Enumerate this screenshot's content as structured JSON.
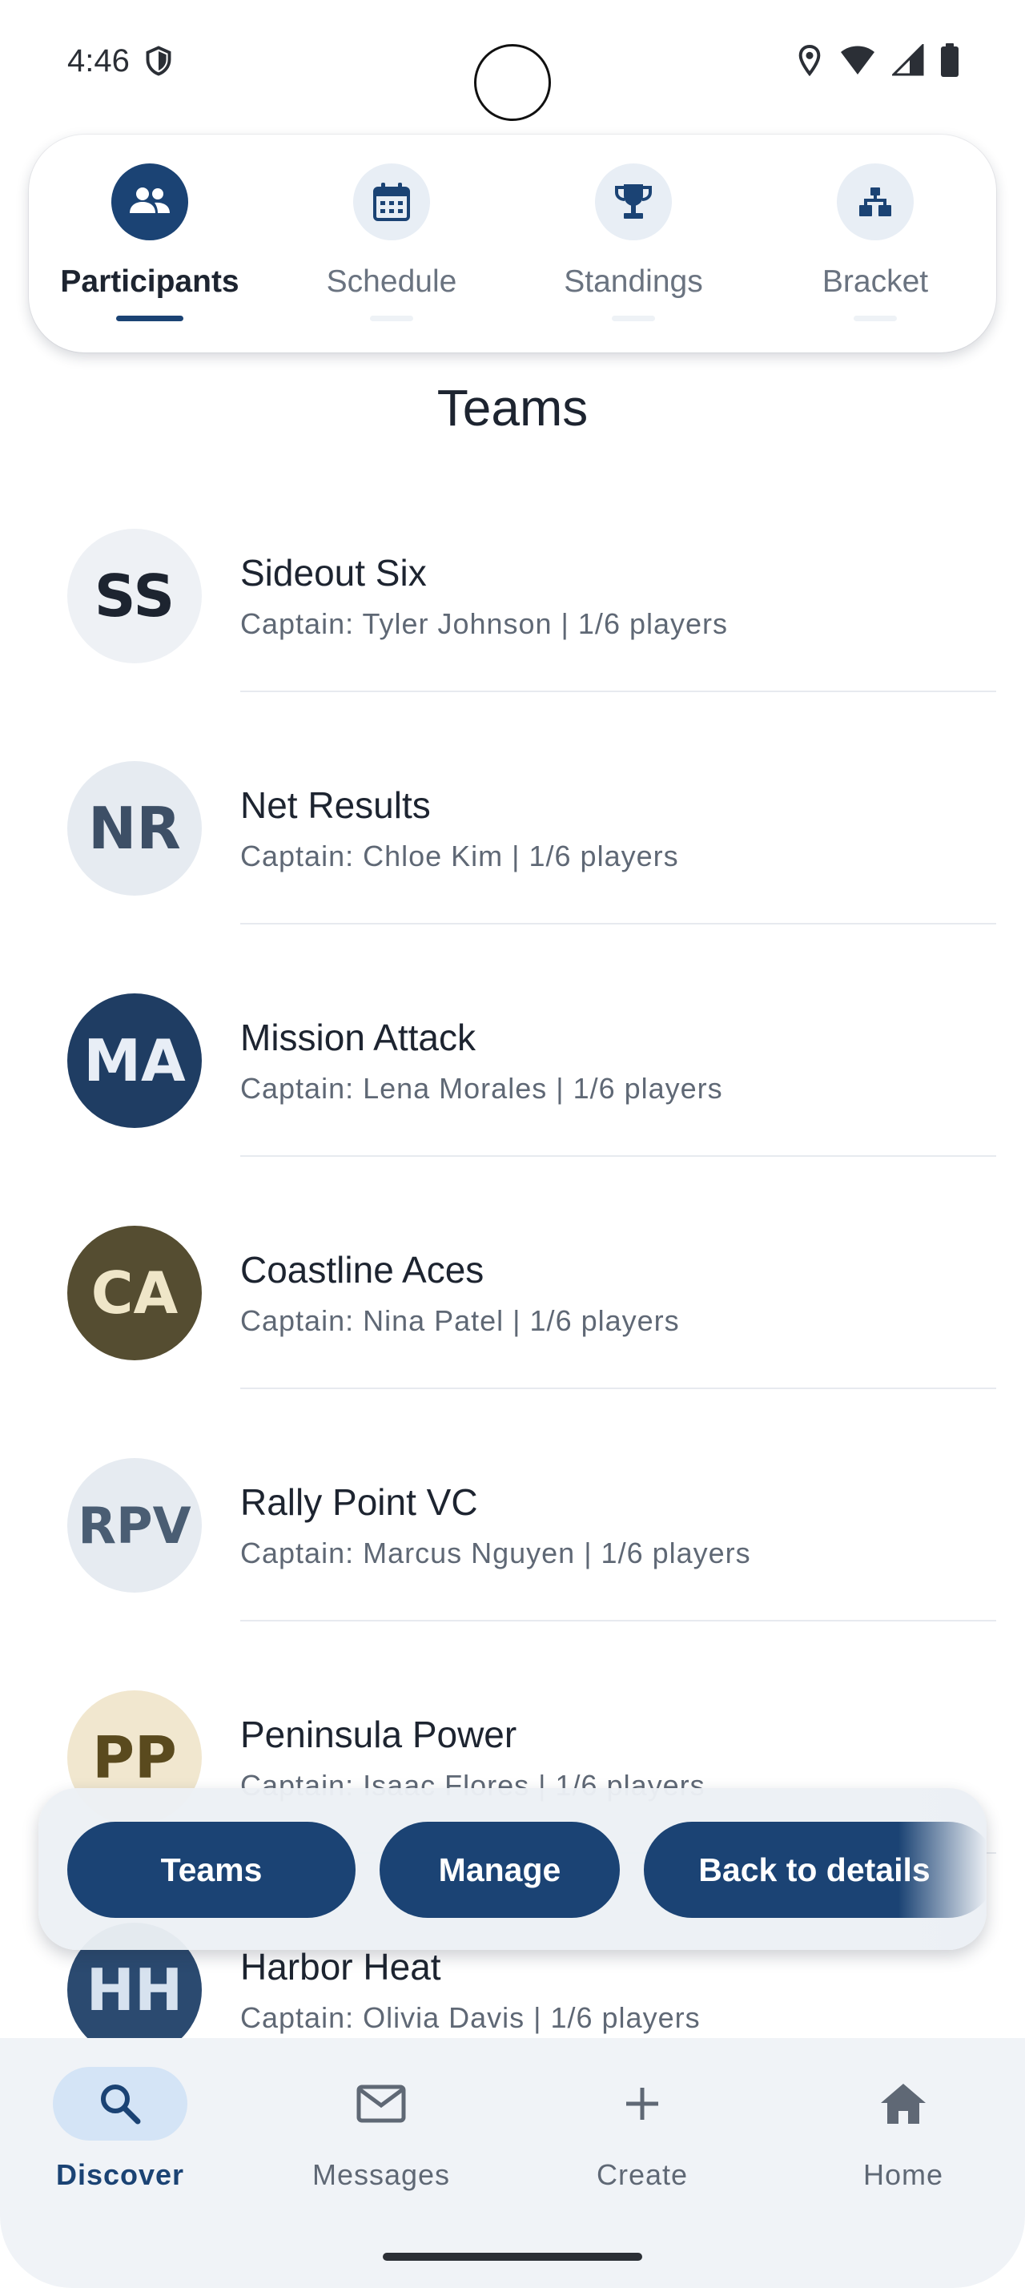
{
  "status_bar": {
    "time": "4:46"
  },
  "tabs": [
    {
      "label": "Participants",
      "icon": "people-icon",
      "active": true
    },
    {
      "label": "Schedule",
      "icon": "calendar-icon",
      "active": false
    },
    {
      "label": "Standings",
      "icon": "trophy-icon",
      "active": false
    },
    {
      "label": "Bracket",
      "icon": "bracket-icon",
      "active": false
    }
  ],
  "section_title": "Teams",
  "teams": [
    {
      "initials": "SS",
      "name": "Sideout Six",
      "subtitle": "Captain: Tyler Johnson | 1/6 players",
      "avatar_bg": "#eef1f5",
      "avatar_fg": "#1d2430"
    },
    {
      "initials": "NR",
      "name": "Net Results",
      "subtitle": "Captain: Chloe Kim | 1/6 players",
      "avatar_bg": "#e6ebf1",
      "avatar_fg": "#3d4f66"
    },
    {
      "initials": "MA",
      "name": "Mission Attack",
      "subtitle": "Captain: Lena Morales | 1/6 players",
      "avatar_bg": "#1f3d63",
      "avatar_fg": "#e8eef6"
    },
    {
      "initials": "CA",
      "name": "Coastline Aces",
      "subtitle": "Captain: Nina Patel | 1/6 players",
      "avatar_bg": "#554d31",
      "avatar_fg": "#efe6c8"
    },
    {
      "initials": "RPV",
      "name": "Rally Point VC",
      "subtitle": "Captain: Marcus Nguyen | 1/6 players",
      "avatar_bg": "#e6ebf1",
      "avatar_fg": "#4a5d73"
    },
    {
      "initials": "PP",
      "name": "Peninsula Power",
      "subtitle": "Captain: Isaac Flores | 1/6 players",
      "avatar_bg": "#f1e7cf",
      "avatar_fg": "#5a4a1e"
    },
    {
      "initials": "HH",
      "name": "Harbor Heat",
      "subtitle": "Captain: Olivia Davis | 1/6 players",
      "avatar_bg": "#2b4a70",
      "avatar_fg": "#d7e2ef"
    }
  ],
  "action_bar": {
    "teams_label": "Teams",
    "manage_label": "Manage",
    "back_label": "Back to details"
  },
  "bottom_nav": [
    {
      "label": "Discover",
      "icon": "search-icon",
      "active": true
    },
    {
      "label": "Messages",
      "icon": "mail-icon",
      "active": false
    },
    {
      "label": "Create",
      "icon": "plus-icon",
      "active": false
    },
    {
      "label": "Home",
      "icon": "home-icon",
      "active": false
    }
  ],
  "colors": {
    "primary": "#1b4374",
    "nav_bg": "#f0f3f7",
    "active_nav_pill": "#d4e4f6"
  }
}
